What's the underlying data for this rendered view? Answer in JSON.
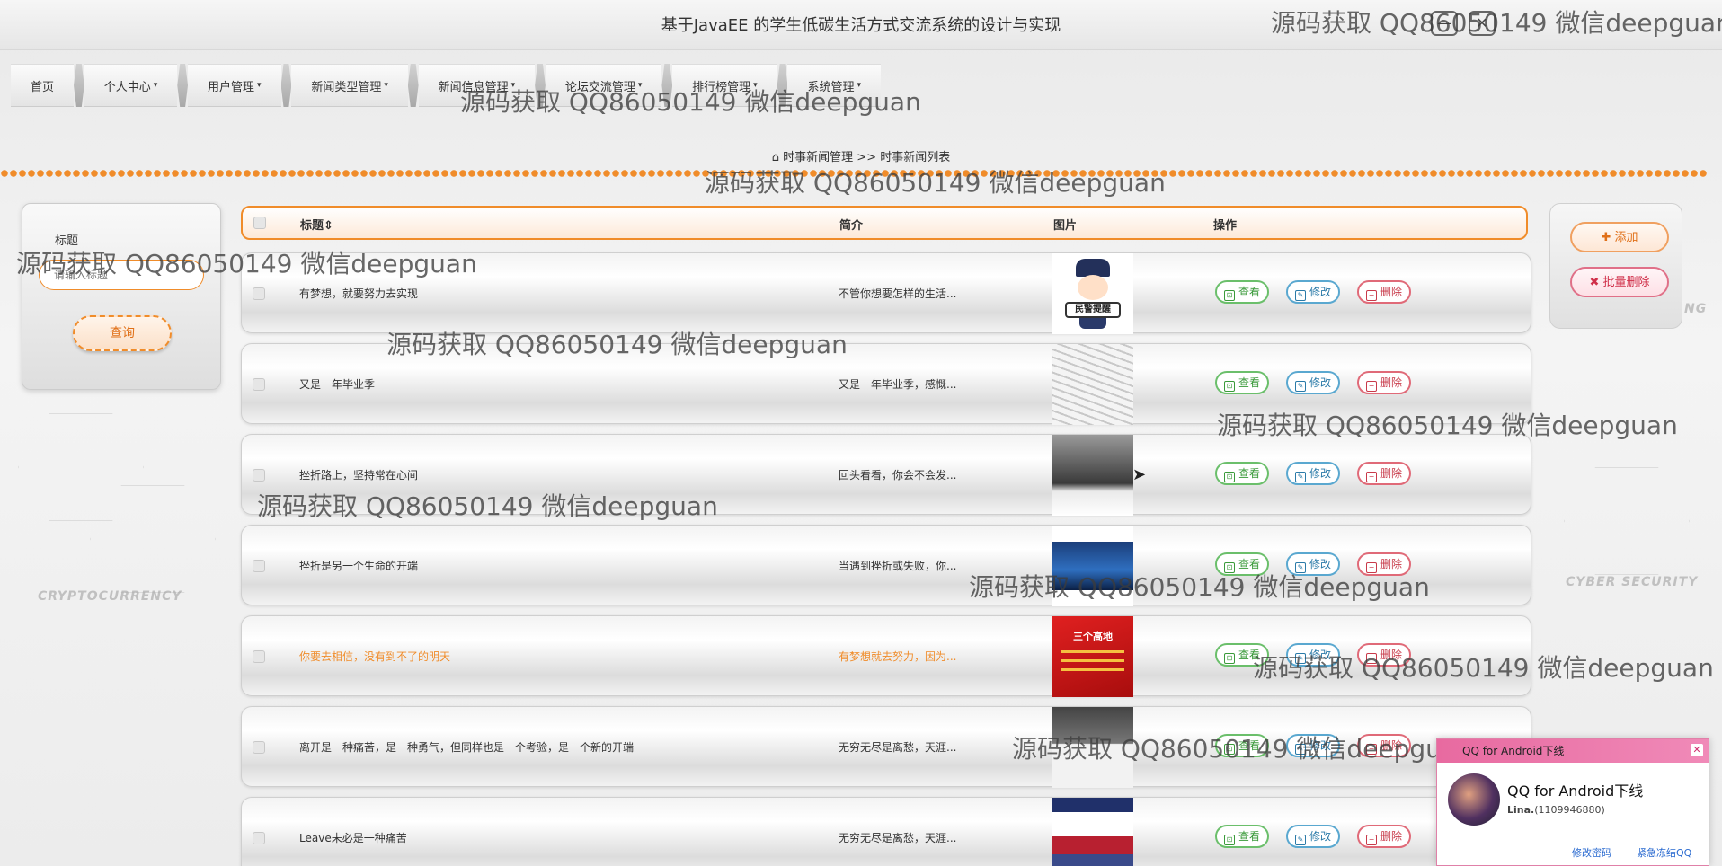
{
  "app": {
    "title": "基于JavaEE 的学生低碳生活方式交流系统的设计与实现"
  },
  "window": {
    "min_icon": "minimize-icon",
    "close_icon": "close-icon",
    "min_glyph": "—",
    "close_glyph": "✕"
  },
  "nav": {
    "items": [
      {
        "label": "首页",
        "has_caret": false
      },
      {
        "label": "个人中心",
        "has_caret": true
      },
      {
        "label": "用户管理",
        "has_caret": true
      },
      {
        "label": "新闻类型管理",
        "has_caret": true
      },
      {
        "label": "新闻信息管理",
        "has_caret": true
      },
      {
        "label": "论坛交流管理",
        "has_caret": true
      },
      {
        "label": "排行榜管理",
        "has_caret": true
      },
      {
        "label": "系统管理",
        "has_caret": true
      }
    ],
    "caret": "▾"
  },
  "breadcrumb": {
    "home_icon": "⌂",
    "path": "时事新闻管理 >> 时事新闻列表"
  },
  "background": {
    "labels": [
      "CRYPTOCURRENCY",
      "CYBER SECURITY",
      "NG"
    ]
  },
  "search": {
    "label": "标题",
    "placeholder": "请输入标题",
    "button": "查询"
  },
  "actions": {
    "add": "添加",
    "add_icon": "✚",
    "batch_delete": "批量删除",
    "batch_icon": "✖"
  },
  "table": {
    "headers": {
      "title": "标题⇕",
      "intro": "简介",
      "image": "图片",
      "ops": "操作"
    },
    "op_labels": {
      "view": "查看",
      "edit": "修改",
      "delete": "删除"
    },
    "rows": [
      {
        "title": "有梦想，就要努力去实现",
        "intro": "不管你想要怎样的生活...",
        "image": "police-cartoon-image",
        "image_text": "民警提醒",
        "highlight": false
      },
      {
        "title": "又是一年毕业季",
        "intro": "又是一年毕业季，感慨...",
        "image": "newspaper-image",
        "image_text": "",
        "highlight": false
      },
      {
        "title": "挫折路上，坚持常在心间",
        "intro": "回头看看，你会不会发...",
        "image": "crowd-photo-image",
        "image_text": "",
        "highlight": false
      },
      {
        "title": "挫折是另一个生命的开端",
        "intro": "当遇到挫折或失败，你...",
        "image": "blue-tech-image",
        "image_text": "",
        "highlight": false
      },
      {
        "title": "你要去相信，没有到不了的明天",
        "intro": "有梦想就去努力，因为...",
        "image": "red-poster-image",
        "image_text": "三个高地",
        "highlight": true
      },
      {
        "title": "离开是一种痛苦，是一种勇气，但同样也是一个考验，是一个新的开端",
        "intro": "无穷无尽是离愁，天涯...",
        "image": "bw-document-image",
        "image_text": "",
        "highlight": false
      },
      {
        "title": "Leave未必是一种痛苦",
        "intro": "无穷无尽是离愁，天涯...",
        "image": "magazine-cover-image",
        "image_text": "",
        "highlight": false
      }
    ]
  },
  "watermark": {
    "text": "源码获取 QQ86050149 微信deepguan"
  },
  "qq_popup": {
    "header": "QQ for Android下线",
    "message": "QQ for Android下线",
    "user": "Lina.",
    "user_id": "(1109946880)",
    "link_change_pwd": "修改密码",
    "link_freeze": "紧急冻结QQ",
    "close_glyph": "✕"
  },
  "colors": {
    "accent": "#f08c2a",
    "view": "#3a9a3a",
    "edit": "#2a7aa8",
    "delete": "#c83a4a",
    "qq_pink": "#e86aa0"
  }
}
